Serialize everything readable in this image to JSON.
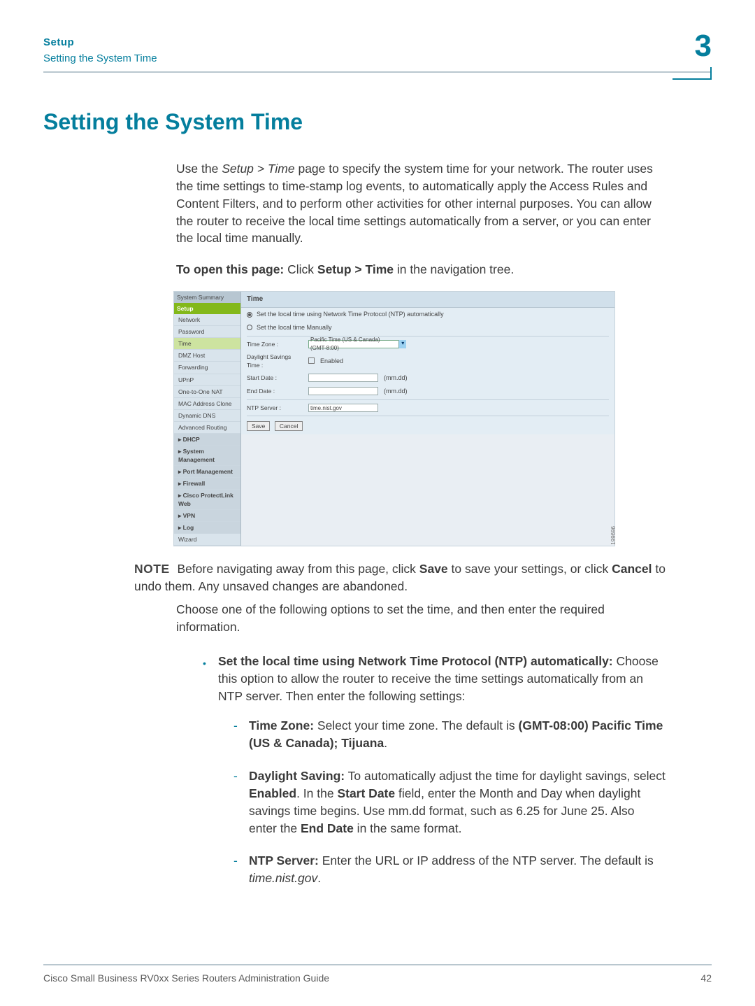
{
  "header": {
    "section": "Setup",
    "subsection": "Setting the System Time",
    "chapter": "3"
  },
  "title": "Setting the System Time",
  "intro": "Use the Setup > Time page to specify the system time for your network. The router uses the time settings to time-stamp log events, to automatically apply the Access Rules and Content Filters, and to perform other activities for other internal purposes. You can allow the router to receive the local time settings automatically from a server, or you can enter the local time manually.",
  "open": {
    "lead": "To open this page: ",
    "rest": "Click ",
    "path": "Setup > Time",
    "tail": " in the navigation tree."
  },
  "note": {
    "label": "NOTE",
    "t1": "Before navigating away from this page, click ",
    "save": "Save",
    "t2": " to save your settings, or click ",
    "cancel": "Cancel",
    "t3": " to undo them. Any unsaved changes are abandoned."
  },
  "choose": "Choose one of the following options to set the time, and then enter the required information.",
  "opt": {
    "head": "Set the local time using Network Time Protocol (NTP) automatically:",
    "body": " Choose this option to allow the router to receive the time settings automatically from an NTP server. Then enter the following settings:",
    "tz": {
      "h": "Time Zone:",
      "b": " Select your time zone. The default is ",
      "def": "(GMT-08:00) Pacific Time (US & Canada); Tijuana",
      "dot": "."
    },
    "ds": {
      "h": "Daylight Saving:",
      "b1": " To automatically adjust the time for daylight savings, select ",
      "en": "Enabled",
      "b2": ". In the ",
      "sd": "Start Date",
      "b3": " field, enter the Month and Day when daylight savings time begins. Use mm.dd format, such as 6.25 for June 25. Also enter the ",
      "ed": "End Date",
      "b4": " in the same format."
    },
    "ntp": {
      "h": "NTP Server:",
      "b": " Enter the URL or IP address of the NTP server. The default is ",
      "def": "time.nist.gov",
      "dot": "."
    }
  },
  "shot": {
    "imgno": "199696",
    "nav": {
      "summary": "System Summary",
      "setup": "Setup",
      "items": [
        "Network",
        "Password",
        "Time",
        "DMZ Host",
        "Forwarding",
        "UPnP",
        "One-to-One NAT",
        "MAC Address Clone",
        "Dynamic DNS",
        "Advanced Routing"
      ],
      "groups": [
        "DHCP",
        "System Management",
        "Port Management",
        "Firewall",
        "Cisco ProtectLink Web",
        "VPN",
        "Log",
        "Wizard"
      ]
    },
    "pane": {
      "title": "Time",
      "r1": "Set the local time using Network Time Protocol (NTP) automatically",
      "r2": "Set the local time Manually",
      "tz_l": "Time Zone :",
      "tz_v": "Pacific Time (US & Canada) (GMT-8:00)",
      "ds_l": "Daylight Savings Time :",
      "ds_v": "Enabled",
      "sd_l": "Start Date :",
      "ed_l": "End Date :",
      "hint": "(mm.dd)",
      "ntp_l": "NTP Server :",
      "ntp_v": "time.nist.gov",
      "save": "Save",
      "cancel": "Cancel"
    }
  },
  "footer": {
    "title": "Cisco Small Business RV0xx Series Routers Administration Guide",
    "page": "42"
  }
}
